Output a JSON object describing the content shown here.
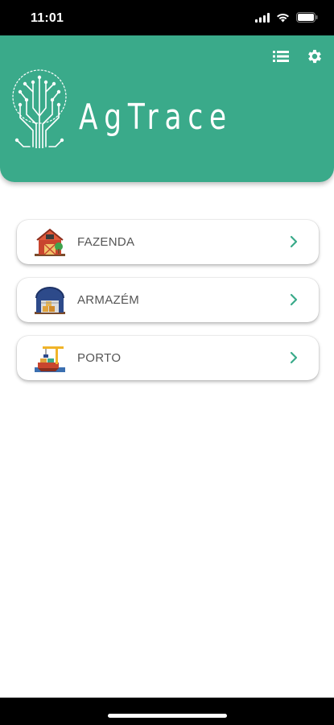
{
  "status_bar": {
    "time": "11:01"
  },
  "header": {
    "app_title": "AgTrace",
    "brand_color": "#3aaa8a",
    "actions": [
      {
        "icon": "list-icon"
      },
      {
        "icon": "gear-icon"
      }
    ]
  },
  "menu": {
    "items": [
      {
        "label": "FAZENDA",
        "icon": "farm-barn-icon"
      },
      {
        "label": "ARMAZÉM",
        "icon": "warehouse-icon"
      },
      {
        "label": "PORTO",
        "icon": "port-crane-icon"
      }
    ],
    "chevron_color": "#3aaa8a"
  }
}
